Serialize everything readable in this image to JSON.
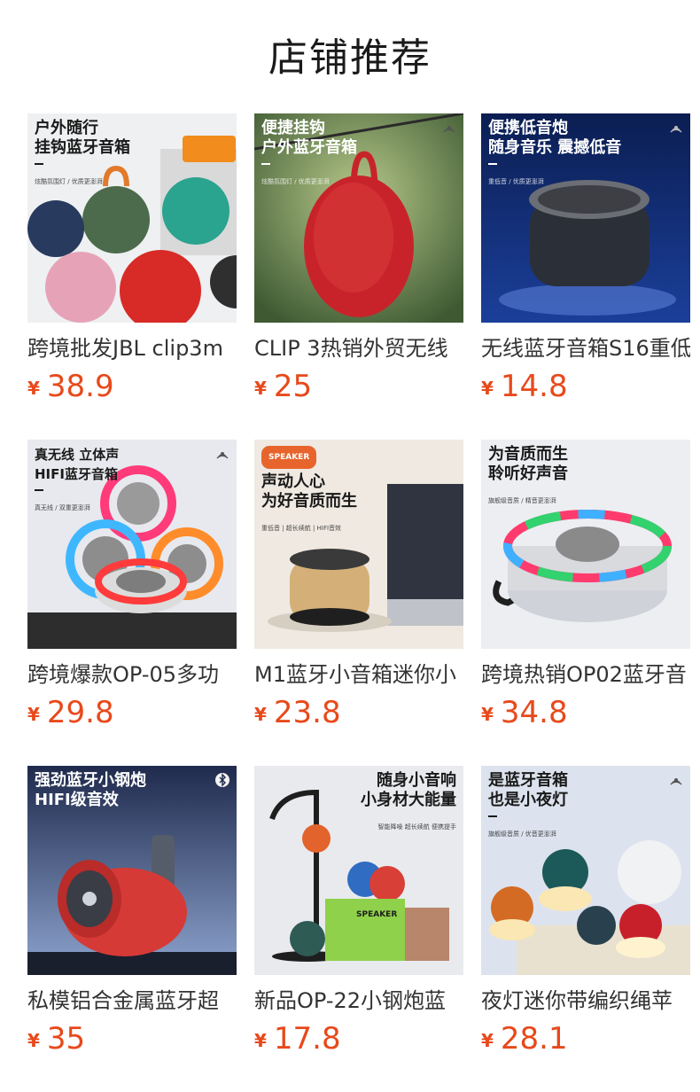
{
  "page": {
    "title": "店铺推荐"
  },
  "currency_symbol": "¥",
  "products": [
    {
      "name": "跨境批发JBL clip3m",
      "price": "38.9",
      "promo": {
        "line1": "户外随行",
        "line2": "挂钩蓝牙音箱",
        "sub": "炫酷氛围灯 / 优质更澎湃"
      }
    },
    {
      "name": "CLIP 3热销外贸无线",
      "price": "25",
      "promo": {
        "line1": "便捷挂钩",
        "line2": "户外蓝牙音箱",
        "sub": "炫酷氛围灯 / 优质更澎湃"
      }
    },
    {
      "name": "无线蓝牙音箱S16重低",
      "price": "14.8",
      "promo": {
        "line1": "便携低音炮",
        "line2": "随身音乐 震撼低音",
        "sub": "重低音 / 优质更澎湃"
      }
    },
    {
      "name": "跨境爆款OP-05多功",
      "price": "29.8",
      "promo": {
        "line1": "真无线 立体声",
        "line2": "HIFI蓝牙音箱",
        "sub": "真无线 / 双重更澎湃"
      }
    },
    {
      "name": "M1蓝牙小音箱迷你小",
      "price": "23.8",
      "promo": {
        "tag": "SPEAKER",
        "line1": "声动人心",
        "line2": "为好音质而生",
        "sub": "重低音 | 超长续航 | HIFI音效"
      }
    },
    {
      "name": "跨境热销OP02蓝牙音",
      "price": "34.8",
      "promo": {
        "line1": "为音质而生",
        "line2": "聆听好声音",
        "sub": "旗舰级音质 / 精音更澎湃"
      }
    },
    {
      "name": "私模铝合金属蓝牙超",
      "price": "35",
      "promo": {
        "line1": "强劲蓝牙小钢炮",
        "line2": "HIFI级音效",
        "sub": ""
      }
    },
    {
      "name": "新品OP-22小钢炮蓝",
      "price": "17.8",
      "promo": {
        "line1": "随身小音响",
        "line2": "小身材大能量",
        "sub": "智能降噪 超长续航 便携提手"
      }
    },
    {
      "name": "夜灯迷你带编织绳苹",
      "price": "28.1",
      "promo": {
        "line1": "是蓝牙音箱",
        "line2": "也是小夜灯",
        "sub": "旗舰级音质 / 优音更澎湃"
      }
    }
  ],
  "colors": {
    "price": "#e8491b",
    "title": "#1a1a1a",
    "name": "#333333"
  }
}
